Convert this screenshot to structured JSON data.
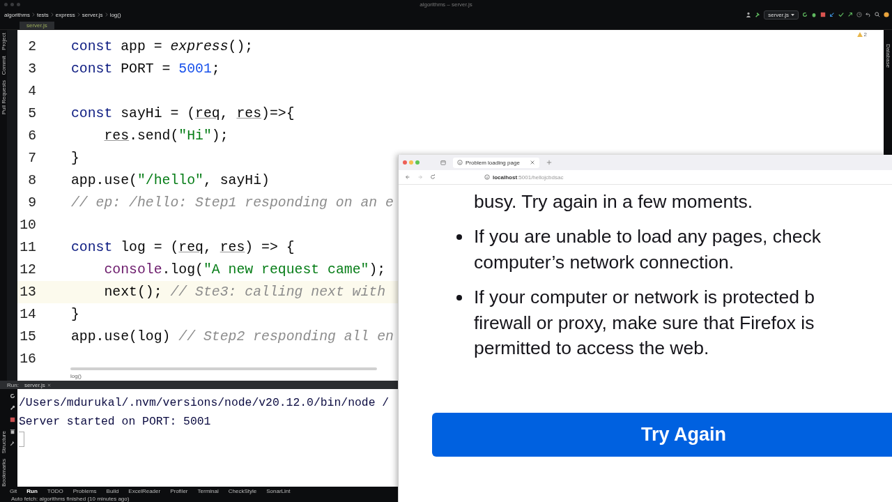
{
  "window": {
    "title": "algorithms – server.js"
  },
  "breadcrumbs": [
    "algorithms",
    "tests",
    "express",
    "server.js",
    "log()"
  ],
  "run_config": {
    "label": "server.js"
  },
  "left_strip": {
    "top": [
      "Project",
      "Commit",
      "Pull Requests"
    ],
    "bottom": [
      "Structure",
      "Bookmarks"
    ]
  },
  "right_strip": [
    "Database"
  ],
  "editor": {
    "tab": {
      "label": "server.js",
      "selected": true
    },
    "warnings": "2",
    "breadcrumb": "log()",
    "lines": [
      {
        "number": "2",
        "current": false,
        "indent": false,
        "tokens": [
          {
            "text": "const",
            "kind": "kw"
          },
          {
            "text": " app = ",
            "kind": "id"
          },
          {
            "text": "express",
            "kind": "call"
          },
          {
            "text": "();",
            "kind": "id"
          }
        ]
      },
      {
        "number": "3",
        "current": false,
        "indent": false,
        "tokens": [
          {
            "text": "const",
            "kind": "kw"
          },
          {
            "text": " PORT = ",
            "kind": "id"
          },
          {
            "text": "5001",
            "kind": "num"
          },
          {
            "text": ";",
            "kind": "id"
          }
        ]
      },
      {
        "number": "4",
        "current": false
      },
      {
        "number": "5",
        "current": false,
        "indent": false,
        "tokens": [
          {
            "text": "const",
            "kind": "kw"
          },
          {
            "text": " sayHi = (",
            "kind": "id"
          },
          {
            "text": "req",
            "kind": "param"
          },
          {
            "text": ", ",
            "kind": "id"
          },
          {
            "text": "res",
            "kind": "param"
          },
          {
            "text": ")=>{",
            "kind": "id"
          }
        ]
      },
      {
        "number": "6",
        "current": false,
        "indent": true,
        "tokens": [
          {
            "text": "res",
            "kind": "param"
          },
          {
            "text": ".send(",
            "kind": "id"
          },
          {
            "text": "\"Hi\"",
            "kind": "str"
          },
          {
            "text": ");",
            "kind": "id"
          }
        ]
      },
      {
        "number": "7",
        "current": false,
        "indent": false,
        "tokens": [
          {
            "text": "}",
            "kind": "id"
          }
        ]
      },
      {
        "number": "8",
        "current": false,
        "indent": false,
        "tokens": [
          {
            "text": "app.use(",
            "kind": "id"
          },
          {
            "text": "\"/hello\"",
            "kind": "str"
          },
          {
            "text": ", sayHi)",
            "kind": "id"
          }
        ]
      },
      {
        "number": "9",
        "current": false,
        "indent": false,
        "tokens": [
          {
            "text": "// ep: /hello: Step1 responding on an e",
            "kind": "cmt"
          }
        ]
      },
      {
        "number": "10",
        "current": false
      },
      {
        "number": "11",
        "current": false,
        "indent": false,
        "tokens": [
          {
            "text": "const",
            "kind": "kw"
          },
          {
            "text": " log = (",
            "kind": "id"
          },
          {
            "text": "req",
            "kind": "param"
          },
          {
            "text": ", ",
            "kind": "id"
          },
          {
            "text": "res",
            "kind": "param"
          },
          {
            "text": ") => {",
            "kind": "id"
          }
        ]
      },
      {
        "number": "12",
        "current": false,
        "indent": true,
        "tokens": [
          {
            "text": "console",
            "kind": "obj"
          },
          {
            "text": ".log(",
            "kind": "id"
          },
          {
            "text": "\"A new request came\"",
            "kind": "str"
          },
          {
            "text": ");",
            "kind": "id"
          }
        ]
      },
      {
        "number": "13",
        "current": true,
        "indent": true,
        "tokens": [
          {
            "text": "next(); ",
            "kind": "id"
          },
          {
            "text": "// Ste3: calling next with",
            "kind": "cmt"
          }
        ]
      },
      {
        "number": "14",
        "current": false,
        "indent": false,
        "tokens": [
          {
            "text": "}",
            "kind": "id"
          }
        ]
      },
      {
        "number": "15",
        "current": false,
        "indent": false,
        "tokens": [
          {
            "text": "app.use(log) ",
            "kind": "id"
          },
          {
            "text": "// Step2 responding all en",
            "kind": "cmt"
          }
        ]
      },
      {
        "number": "16",
        "current": false
      }
    ]
  },
  "run_panel": {
    "label": "Run:",
    "tab": "server.js",
    "output": [
      "/Users/mdurukal/.nvm/versions/node/v20.12.0/bin/node /",
      "Server started on PORT: 5001"
    ]
  },
  "tool_tabs": [
    {
      "label": "Git",
      "selected": false
    },
    {
      "label": "Run",
      "selected": true
    },
    {
      "label": "TODO",
      "selected": false
    },
    {
      "label": "Problems",
      "selected": false
    },
    {
      "label": "Build",
      "selected": false
    },
    {
      "label": "ExcelReader",
      "selected": false
    },
    {
      "label": "Profiler",
      "selected": false
    },
    {
      "label": "Terminal",
      "selected": false
    },
    {
      "label": "CheckStyle",
      "selected": false
    },
    {
      "label": "SonarLint",
      "selected": false
    }
  ],
  "status": "Auto fetch: algorithms finished (10 minutes ago)",
  "browser": {
    "tab": "Problem loading page",
    "url_host": "localhost",
    "url_rest": ":5001/hellojcbdsac",
    "continuation": "busy. Try again in a few moments.",
    "bullets": [
      {
        "lines": [
          "If you are unable to load any pages, check",
          "computer’s network connection."
        ]
      },
      {
        "lines": [
          "If your computer or network is protected b",
          "firewall or proxy, make sure that Firefox is",
          "permitted to access the web."
        ]
      }
    ],
    "button": "Try Again"
  }
}
